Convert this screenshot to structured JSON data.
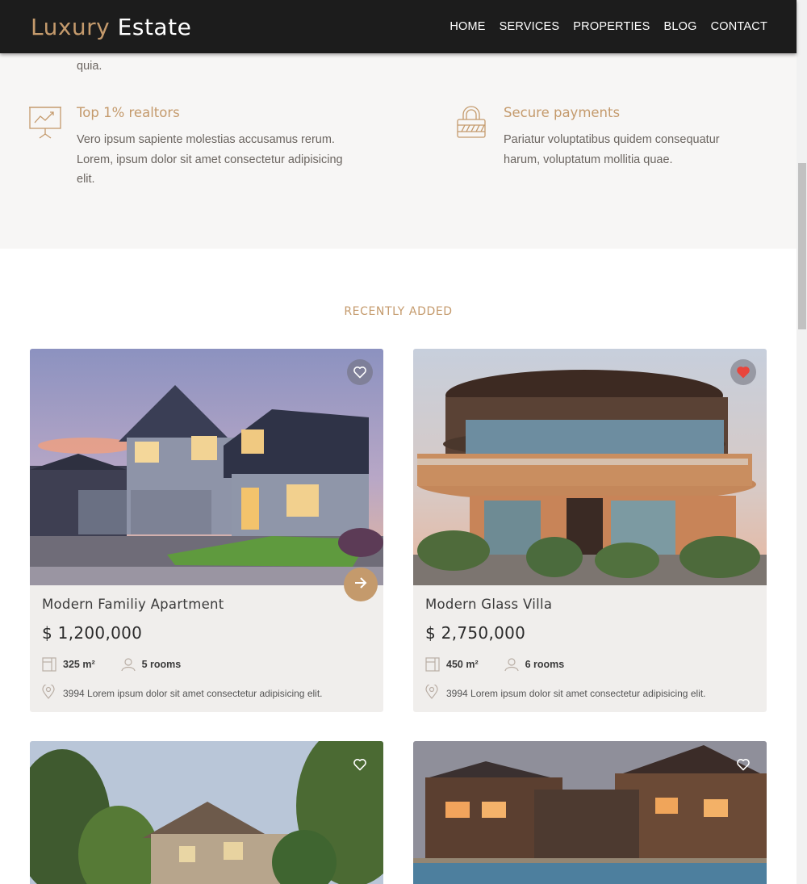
{
  "brand": {
    "part1": "Luxury",
    "part2": "Estate"
  },
  "nav": [
    "HOME",
    "SERVICES",
    "PROPERTIES",
    "BLOG",
    "CONTACT"
  ],
  "features": {
    "cut_text": "quia.",
    "items": [
      {
        "icon": "chart-presentation-icon",
        "title": "Top 1% realtors",
        "text": "Vero ipsum sapiente molestias accusamus rerum. Lorem, ipsum dolor sit amet consectetur adipisicing elit."
      },
      {
        "icon": "lock-icon",
        "title": "Secure payments",
        "text": "Pariatur voluptatibus quidem consequatur harum, voluptatum mollitia quae."
      }
    ]
  },
  "section_title": "RECENTLY ADDED",
  "listings": [
    {
      "title": "Modern Familiy Apartment",
      "price": "$ 1,200,000",
      "area": "325 m²",
      "rooms": "5 rooms",
      "address": "3994 Lorem ipsum dolor sit amet consectetur adipisicing elit.",
      "favorited": false
    },
    {
      "title": "Modern Glass Villa",
      "price": "$ 2,750,000",
      "area": "450 m²",
      "rooms": "6 rooms",
      "address": "3994 Lorem ipsum dolor sit amet consectetur adipisicing elit.",
      "favorited": true
    },
    {
      "favorited": false
    },
    {
      "favorited": false
    }
  ],
  "colors": {
    "accent": "#c49a6c",
    "header_bg": "#1c1c1c",
    "fav_active": "#e8453c"
  }
}
